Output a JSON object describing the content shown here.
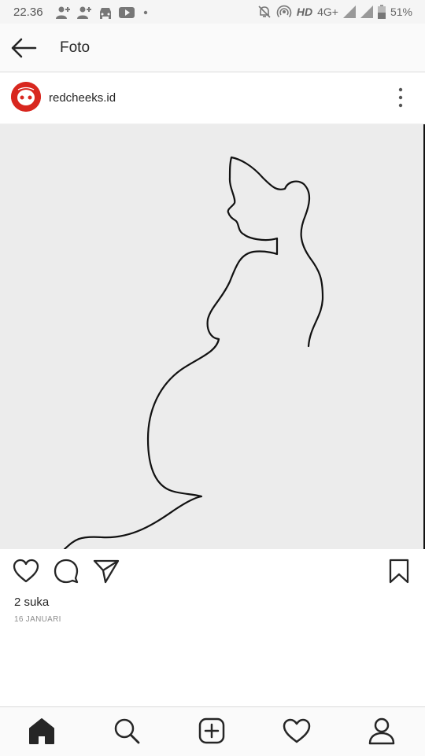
{
  "status_bar": {
    "time": "22.36",
    "network": "HD",
    "network_type": "4G+",
    "battery": "51%",
    "left_icons": [
      "add-person-icon",
      "add-person-icon",
      "car-icon",
      "youtube-icon",
      "dot-icon"
    ],
    "right_icons": [
      "muted-bell-icon",
      "hotspot-icon",
      "signal-icon",
      "signal-icon",
      "battery-icon"
    ]
  },
  "app_bar": {
    "title": "Foto",
    "back_icon": "arrow-left-icon"
  },
  "post": {
    "username": "redcheeks.id",
    "avatar_color": "#d8271f",
    "more_icon": "more-vertical-icon",
    "image_description_icon": "line-art-photo",
    "likes": "2 suka",
    "date": "16 JANUARI"
  },
  "actions": {
    "icons": [
      "heart-icon",
      "comment-icon",
      "share-icon",
      "bookmark-icon"
    ]
  },
  "bottom_nav": {
    "items": [
      "home-icon",
      "search-icon",
      "add-post-icon",
      "activity-heart-icon",
      "profile-icon"
    ]
  },
  "colors": {
    "photo_bg": "#ececec",
    "text": "#262626",
    "muted": "#8e8e8e"
  }
}
